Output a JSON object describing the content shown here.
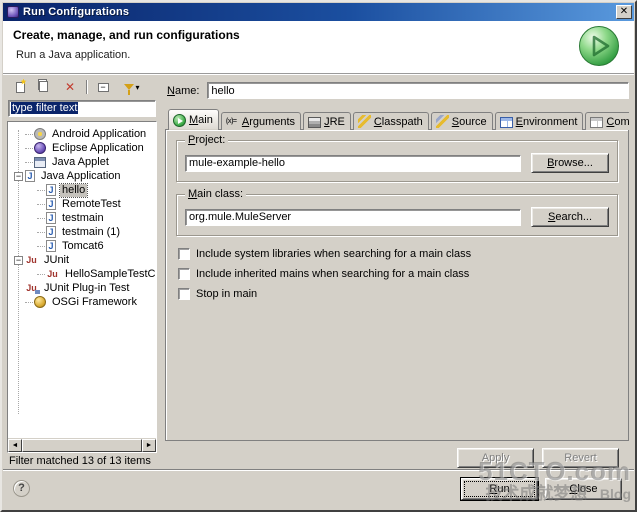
{
  "window": {
    "title": "Run Configurations",
    "close_symbol": "✕"
  },
  "banner": {
    "title": "Create, manage, and run configurations",
    "subtitle": "Run a Java application."
  },
  "sidebar": {
    "filter_value": "type filter text",
    "status": "Filter matched 13 of 13 items",
    "tree": [
      {
        "label": "Android Application",
        "level": 0,
        "selected": false
      },
      {
        "label": "Eclipse Application",
        "level": 0,
        "selected": false
      },
      {
        "label": "Java Applet",
        "level": 0,
        "selected": false
      },
      {
        "label": "Java Application",
        "level": 0,
        "expanded": true,
        "expander": "−",
        "selected": false
      },
      {
        "label": "hello",
        "level": 1,
        "selected": true
      },
      {
        "label": "RemoteTest",
        "level": 1,
        "selected": false
      },
      {
        "label": "testmain",
        "level": 1,
        "selected": false
      },
      {
        "label": "testmain (1)",
        "level": 1,
        "selected": false
      },
      {
        "label": "Tomcat6",
        "level": 1,
        "selected": false
      },
      {
        "label": "JUnit",
        "level": 0,
        "expanded": true,
        "expander": "−",
        "selected": false
      },
      {
        "label": "HelloSampleTestCase",
        "level": 1,
        "selected": false
      },
      {
        "label": "JUnit Plug-in Test",
        "level": 0,
        "selected": false
      },
      {
        "label": "OSGi Framework",
        "level": 0,
        "selected": false
      }
    ]
  },
  "main": {
    "name_label": "Name:",
    "name_value": "hello",
    "tabs": [
      {
        "label": "Main",
        "selected": true
      },
      {
        "label": "Arguments",
        "selected": false
      },
      {
        "label": "JRE",
        "selected": false
      },
      {
        "label": "Classpath",
        "selected": false
      },
      {
        "label": "Source",
        "selected": false
      },
      {
        "label": "Environment",
        "selected": false
      },
      {
        "label": "Common",
        "selected": false
      }
    ],
    "project": {
      "label": "Project:",
      "value": "mule-example-hello",
      "button": "Browse..."
    },
    "main_class": {
      "label": "Main class:",
      "value": "org.mule.MuleServer",
      "button": "Search..."
    },
    "checkboxes": [
      {
        "label": "Include system libraries when searching for a main class",
        "checked": false
      },
      {
        "label": "Include inherited mains when searching for a main class",
        "checked": false
      },
      {
        "label": "Stop in main",
        "checked": false
      }
    ],
    "apply_label": "Apply",
    "revert_label": "Revert"
  },
  "footer": {
    "help_symbol": "?",
    "run_label": "Run",
    "close_label": "Close"
  },
  "watermark": {
    "brand": "51CTO.com",
    "slogan": "技术成就梦想",
    "suffix": "Blog"
  },
  "icons": {
    "java_glyph": "J",
    "junit_glyph": "Ju",
    "arguments_glyph": "(x)=",
    "delete_glyph": "✕",
    "filter_caret": "▾",
    "scroll_left": "◄",
    "scroll_right": "►"
  },
  "colors": {
    "titlebar_start": "#0a246a",
    "titlebar_end": "#5a9ade",
    "dialog_bg": "#d4d0c8",
    "banner_bg": "#ffffff",
    "selection_bg": "#0a246a",
    "tree_selection_bg": "#c6c3bd",
    "run_icon_green": "#3fae49"
  }
}
